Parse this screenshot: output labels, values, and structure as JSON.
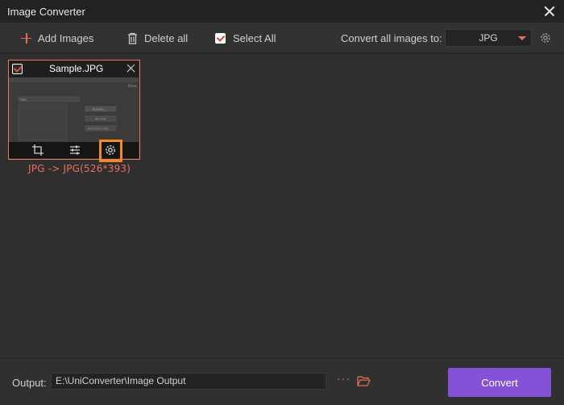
{
  "window": {
    "title": "Image Converter"
  },
  "toolbar": {
    "add_images": "Add Images",
    "delete_all": "Delete all",
    "select_all": "Select All",
    "convert_all_label": "Convert all images to:",
    "format_selected": "JPG"
  },
  "card": {
    "file_name": "Sample.JPG",
    "conversion_info": "JPG -> JPG(526*393)",
    "thumbnail_texts": {
      "top_right": "Done",
      "dropdown": "Files",
      "btn1": "Browse...",
      "btn2": "Remove",
      "btn3": "Add Drive Files"
    }
  },
  "footer": {
    "output_label": "Output:",
    "output_path": "E:\\UniConverter\\Image Output",
    "more": "···",
    "convert_button": "Convert"
  },
  "colors": {
    "accent": "#e8795a",
    "highlight": "#f28a2a",
    "convert": "#8352d6"
  }
}
